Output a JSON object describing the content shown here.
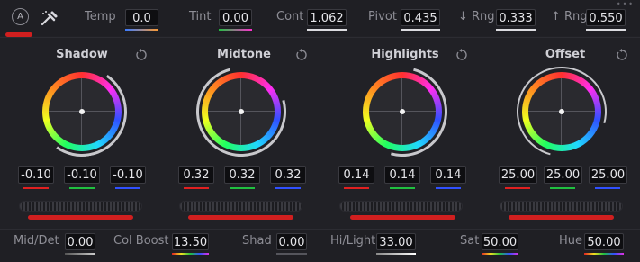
{
  "colors": {
    "accent_red": "#d11f1f",
    "red_channel": "#e02020",
    "green_channel": "#20c040",
    "blue_channel": "#3050ff",
    "panel_bg": "#212126",
    "value_box_bg": "#0e0e11"
  },
  "topbar": {
    "auto_label": "A",
    "picker_icon": "eyedropper-icon",
    "params": [
      {
        "label": "Temp",
        "value": "0.0"
      },
      {
        "label": "Tint",
        "value": "0.00"
      },
      {
        "label": "Cont",
        "value": "1.062"
      },
      {
        "label": "Pivot",
        "value": "0.435"
      },
      {
        "label": "↓ Rng",
        "value": "0.333"
      },
      {
        "label": "↑ Rng",
        "value": "0.550"
      }
    ]
  },
  "wheels": [
    {
      "title": "Shadow",
      "values": [
        "-0.10",
        "-0.10",
        "-0.10"
      ]
    },
    {
      "title": "Midtone",
      "values": [
        "0.32",
        "0.32",
        "0.32"
      ]
    },
    {
      "title": "Highlights",
      "values": [
        "0.14",
        "0.14",
        "0.14"
      ]
    },
    {
      "title": "Offset",
      "values": [
        "25.00",
        "25.00",
        "25.00"
      ]
    }
  ],
  "bottombar": {
    "params": [
      {
        "label": "Mid/Det",
        "value": "0.00"
      },
      {
        "label": "Col Boost",
        "value": "13.50"
      },
      {
        "label": "Shad",
        "value": "0.00"
      },
      {
        "label": "Hi/Light",
        "value": "33.00"
      },
      {
        "label": "Sat",
        "value": "50.00"
      },
      {
        "label": "Hue",
        "value": "50.00"
      }
    ]
  }
}
